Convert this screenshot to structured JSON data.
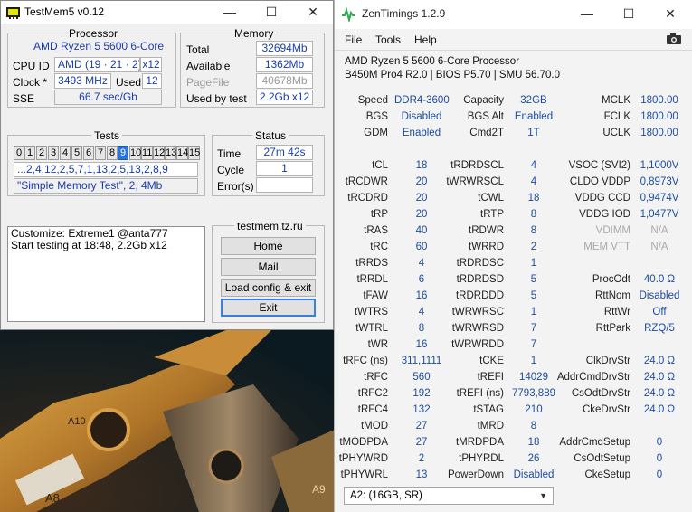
{
  "testmem": {
    "title": "TestMem5 v0.12",
    "processor": {
      "group": "Processor",
      "name": "AMD Ryzen 5 5600 6-Core",
      "cpuid_label": "CPU ID",
      "cpuid_value": "AMD  (19 · 21 · 2)",
      "cpuid_mult": "x12",
      "clock_label": "Clock *",
      "clock_value": "3493 MHz",
      "used_label": "Used",
      "used_value": "12",
      "sse_label": "SSE",
      "sse_value": "66.7 sec/Gb"
    },
    "memory": {
      "group": "Memory",
      "rows": [
        {
          "label": "Total",
          "value": "32694Mb",
          "muted": false
        },
        {
          "label": "Available",
          "value": "1362Mb",
          "muted": false
        },
        {
          "label": "PageFile",
          "value": "40678Mb",
          "muted": true
        },
        {
          "label": "Used by test",
          "value": "2.2Gb x12",
          "muted": false
        }
      ]
    },
    "tests": {
      "group": "Tests",
      "cells": [
        "0",
        "1",
        "2",
        "3",
        "4",
        "5",
        "6",
        "7",
        "8",
        "9",
        "10",
        "11",
        "12",
        "13",
        "14",
        "15"
      ],
      "active_index": 9,
      "sequence": "...2,4,12,2,5,7,1,13,2,5,13,2,8,9",
      "current": "\"Simple Memory Test\", 2, 4Mb"
    },
    "status": {
      "group": "Status",
      "time_label": "Time",
      "time_value": "27m 42s",
      "cycle_label": "Cycle",
      "cycle_value": "1",
      "errors_label": "Error(s)",
      "errors_value": ""
    },
    "log": {
      "line1": "Customize: Extreme1 @anta777",
      "line2": "Start testing at 18:48, 2.2Gb x12"
    },
    "site": {
      "group": "testmem.tz.ru",
      "home": "Home",
      "mail": "Mail",
      "load": "Load config & exit",
      "exit": "Exit"
    }
  },
  "zen": {
    "title": "ZenTimings 1.2.9",
    "menu": [
      "File",
      "Tools",
      "Help"
    ],
    "cpu": "AMD Ryzen 5 5600 6-Core Processor",
    "board": "B450M Pro4 R2.0 | BIOS P5.70 | SMU 56.70.0",
    "col1": [
      {
        "label": "Speed",
        "value": "DDR4-3600"
      },
      {
        "label": "BGS",
        "value": "Disabled"
      },
      {
        "label": "GDM",
        "value": "Enabled"
      },
      {
        "label": "",
        "value": ""
      },
      {
        "label": "tCL",
        "value": "18"
      },
      {
        "label": "tRCDWR",
        "value": "20"
      },
      {
        "label": "tRCDRD",
        "value": "20"
      },
      {
        "label": "tRP",
        "value": "20"
      },
      {
        "label": "tRAS",
        "value": "40"
      },
      {
        "label": "tRC",
        "value": "60"
      },
      {
        "label": "tRRDS",
        "value": "4"
      },
      {
        "label": "tRRDL",
        "value": "6"
      },
      {
        "label": "tFAW",
        "value": "16"
      },
      {
        "label": "tWTRS",
        "value": "4"
      },
      {
        "label": "tWTRL",
        "value": "8"
      },
      {
        "label": "tWR",
        "value": "16"
      },
      {
        "label": "tRFC (ns)",
        "value": "311,1111"
      },
      {
        "label": "tRFC",
        "value": "560"
      },
      {
        "label": "tRFC2",
        "value": "192"
      },
      {
        "label": "tRFC4",
        "value": "132"
      },
      {
        "label": "tMOD",
        "value": "27"
      },
      {
        "label": "tMODPDA",
        "value": "27"
      },
      {
        "label": "tPHYWRD",
        "value": "2"
      },
      {
        "label": "tPHYWRL",
        "value": "13"
      }
    ],
    "col2": [
      {
        "label": "Capacity",
        "value": "32GB"
      },
      {
        "label": "BGS Alt",
        "value": "Enabled"
      },
      {
        "label": "Cmd2T",
        "value": "1T"
      },
      {
        "label": "",
        "value": ""
      },
      {
        "label": "tRDRDSCL",
        "value": "4"
      },
      {
        "label": "tWRWRSCL",
        "value": "4"
      },
      {
        "label": "tCWL",
        "value": "18"
      },
      {
        "label": "tRTP",
        "value": "8"
      },
      {
        "label": "tRDWR",
        "value": "8"
      },
      {
        "label": "tWRRD",
        "value": "2"
      },
      {
        "label": "tRDRDSC",
        "value": "1"
      },
      {
        "label": "tRDRDSD",
        "value": "5"
      },
      {
        "label": "tRDRDDD",
        "value": "5"
      },
      {
        "label": "tWRWRSC",
        "value": "1"
      },
      {
        "label": "tWRWRSD",
        "value": "7"
      },
      {
        "label": "tWRWRDD",
        "value": "7"
      },
      {
        "label": "tCKE",
        "value": "1"
      },
      {
        "label": "tREFI",
        "value": "14029"
      },
      {
        "label": "tREFI (ns)",
        "value": "7793,889"
      },
      {
        "label": "tSTAG",
        "value": "210"
      },
      {
        "label": "tMRD",
        "value": "8"
      },
      {
        "label": "tMRDPDA",
        "value": "18"
      },
      {
        "label": "tPHYRDL",
        "value": "26"
      },
      {
        "label": "PowerDown",
        "value": "Disabled"
      }
    ],
    "col3": [
      {
        "label": "MCLK",
        "value": "1800.00",
        "muted": false
      },
      {
        "label": "FCLK",
        "value": "1800.00",
        "muted": false
      },
      {
        "label": "UCLK",
        "value": "1800.00",
        "muted": false
      },
      {
        "label": "",
        "value": "",
        "muted": false
      },
      {
        "label": "VSOC (SVI2)",
        "value": "1,1000V",
        "muted": false
      },
      {
        "label": "CLDO VDDP",
        "value": "0,8973V",
        "muted": false
      },
      {
        "label": "VDDG CCD",
        "value": "0,9474V",
        "muted": false
      },
      {
        "label": "VDDG IOD",
        "value": "1,0477V",
        "muted": false
      },
      {
        "label": "VDIMM",
        "value": "N/A",
        "muted": true
      },
      {
        "label": "MEM VTT",
        "value": "N/A",
        "muted": true
      },
      {
        "label": "",
        "value": "",
        "muted": false
      },
      {
        "label": "ProcOdt",
        "value": "40.0 Ω",
        "muted": false
      },
      {
        "label": "RttNom",
        "value": "Disabled",
        "muted": false
      },
      {
        "label": "RttWr",
        "value": "Off",
        "muted": false
      },
      {
        "label": "RttPark",
        "value": "RZQ/5",
        "muted": false
      },
      {
        "label": "",
        "value": "",
        "muted": false
      },
      {
        "label": "ClkDrvStr",
        "value": "24.0 Ω",
        "muted": false
      },
      {
        "label": "AddrCmdDrvStr",
        "value": "24.0 Ω",
        "muted": false
      },
      {
        "label": "CsOdtDrvStr",
        "value": "24.0 Ω",
        "muted": false
      },
      {
        "label": "CkeDrvStr",
        "value": "24.0 Ω",
        "muted": false
      },
      {
        "label": "",
        "value": "",
        "muted": false
      },
      {
        "label": "AddrCmdSetup",
        "value": "0",
        "muted": false
      },
      {
        "label": "CsOdtSetup",
        "value": "0",
        "muted": false
      },
      {
        "label": "CkeSetup",
        "value": "0",
        "muted": false
      }
    ],
    "dimm_select": "A2:  (16GB, SR)"
  },
  "desktop": {
    "marks": [
      "A10",
      "A8",
      "A9"
    ]
  },
  "colors": {
    "value_blue": "#1c4b9e",
    "active_cell": "#2a74d8",
    "zen_logo": "#2fa84f"
  }
}
